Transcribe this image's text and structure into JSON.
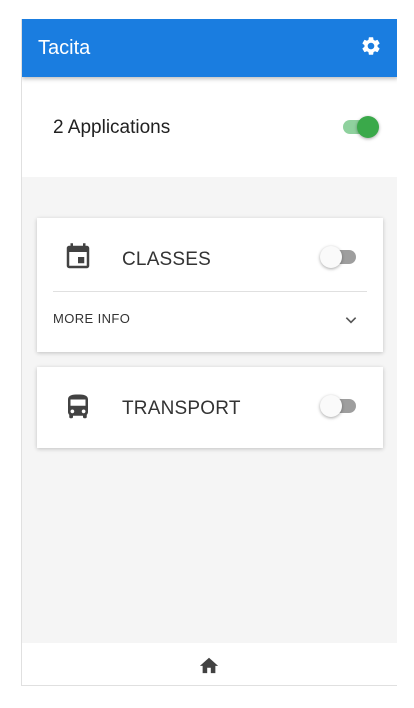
{
  "appbar": {
    "title": "Tacita",
    "settings_icon": "gear-icon"
  },
  "summary": {
    "label": "2 Applications",
    "toggle_on": true
  },
  "applications": [
    {
      "name": "CLASSES",
      "icon": "calendar-icon",
      "enabled": false,
      "more_info_label": "MORE INFO",
      "more_info_icon": "chevron-down-icon"
    },
    {
      "name": "TRANSPORT",
      "icon": "bus-icon",
      "enabled": false
    }
  ],
  "bottom_nav": {
    "home_icon": "home-icon"
  },
  "colors": {
    "primary": "#1a7de0",
    "toggle_on": "#3aa94a",
    "toggle_on_track": "#8fd19e",
    "toggle_off_track": "#9e9e9e"
  }
}
